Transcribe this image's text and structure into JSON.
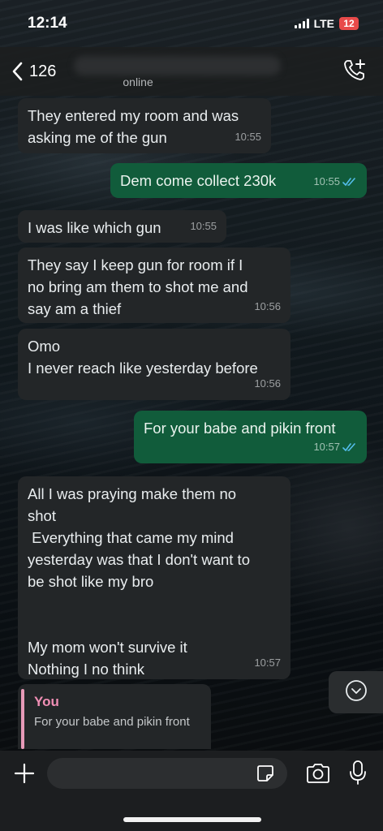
{
  "status_bar": {
    "time": "12:14",
    "network": "LTE",
    "battery": "12",
    "battery_color": "#e84a4a"
  },
  "header": {
    "back_count": "126",
    "contact_status": "online",
    "back_icon": "chevron-left-icon",
    "call_icon": "add-call-icon"
  },
  "messages": [
    {
      "dir": "in",
      "text": "They entered my room and was\nasking me of the gun",
      "time": "10:55"
    },
    {
      "dir": "out",
      "text": "Dem come collect 230k",
      "time": "10:55",
      "read": true
    },
    {
      "dir": "in",
      "text": "I was like which gun",
      "time": "10:55"
    },
    {
      "dir": "in",
      "text": "They say I keep gun for room if I\nno bring am them to shot me and\nsay am a thief",
      "time": "10:56"
    },
    {
      "dir": "in",
      "text": "Omo\nI never reach like yesterday before",
      "time": "10:56"
    },
    {
      "dir": "out",
      "text": "For your babe and pikin front",
      "time": "10:57",
      "read": true
    },
    {
      "dir": "in",
      "text": "All I was praying make them no\nshot\n Everything that came my mind\nyesterday was that I don't want to\nbe shot like my bro\n\n\nMy mom won't survive it\nNothing I no think",
      "time": "10:57"
    }
  ],
  "reply_preview": {
    "author": "You",
    "text": "For your babe and pikin front",
    "accent": "#e79ab8"
  },
  "input_bar": {
    "placeholder": "",
    "icons": [
      "plus-icon",
      "sticker-icon",
      "camera-icon",
      "microphone-icon"
    ]
  },
  "colors": {
    "incoming_bubble": "#232628",
    "outgoing_bubble": "#115c3b",
    "read_ticks": "#53bdeb"
  }
}
